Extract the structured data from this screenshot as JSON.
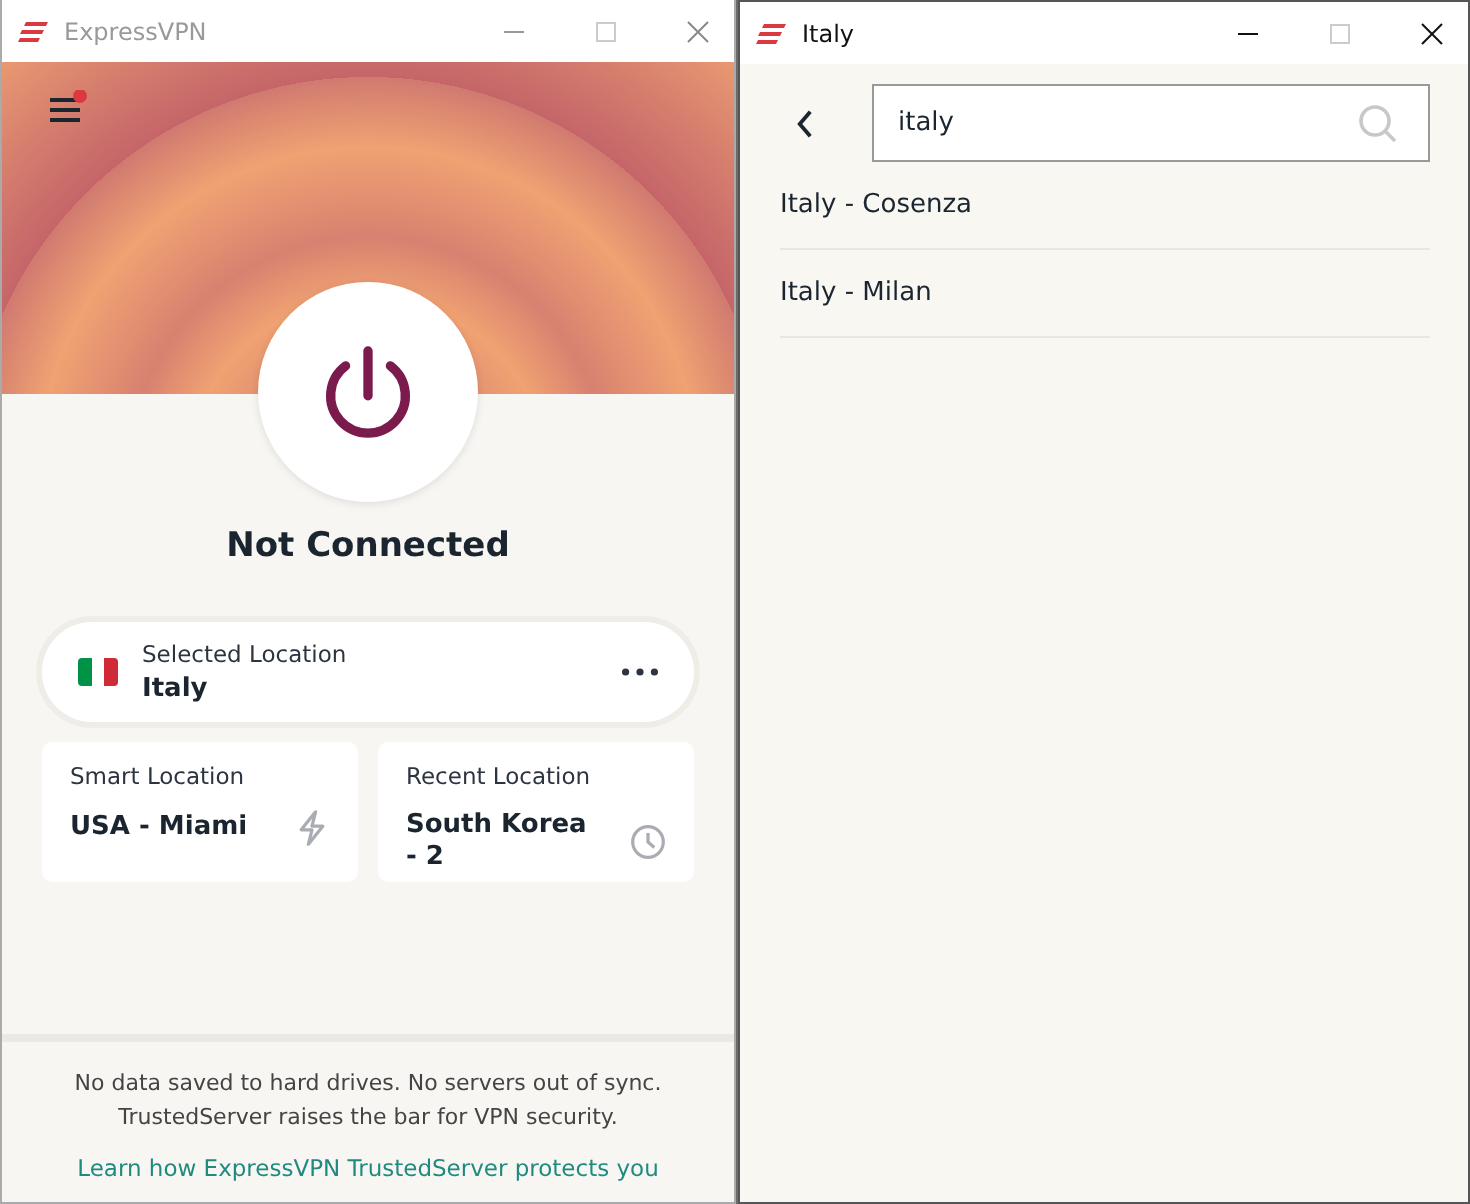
{
  "windows": [
    {
      "title": "ExpressVPN",
      "active": false,
      "menu_badge": true,
      "status": "Not Connected",
      "connected": false,
      "selected_location": {
        "label": "Selected Location",
        "name": "Italy"
      },
      "cards": [
        {
          "label": "Smart Location",
          "name": "USA - Miami",
          "kind": "smart"
        },
        {
          "label": "Recent Location",
          "name": "South Korea - 2",
          "kind": "recent"
        }
      ],
      "footer": {
        "text": "No data saved to hard drives. No servers out of sync. TrustedServer raises the bar for VPN security.",
        "link": "Learn how ExpressVPN TrustedServer protects you"
      }
    },
    {
      "title": "Italy",
      "active": true,
      "search": {
        "value": "italy"
      },
      "results": [
        "Italy - Cosenza",
        "Italy - Milan"
      ]
    }
  ]
}
